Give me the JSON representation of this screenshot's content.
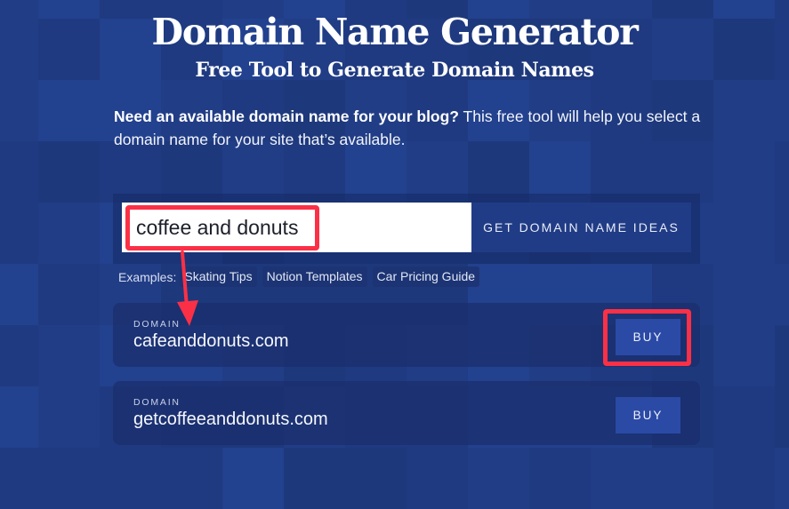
{
  "header": {
    "title": "Domain Name Generator",
    "subtitle": "Free Tool to Generate Domain Names"
  },
  "intro": {
    "bold": "Need an available domain name for your blog?",
    "text": " This free tool will help you select a domain name for your site that’s available."
  },
  "search": {
    "value": "coffee and donuts",
    "placeholder": "",
    "button_label": "GET DOMAIN NAME IDEAS"
  },
  "examples": {
    "label": "Examples:",
    "items": [
      "Skating Tips",
      "Notion Templates",
      "Car Pricing Guide"
    ]
  },
  "results": [
    {
      "label": "DOMAIN",
      "domain": "cafeanddonuts.com",
      "button_label": "BUY"
    },
    {
      "label": "DOMAIN",
      "domain": "getcoffeeanddonuts.com",
      "button_label": "BUY"
    }
  ],
  "annotations": {
    "highlight_color": "#fb3046",
    "items": [
      "search-input-highlight",
      "buy-button-highlight",
      "arrow-input-to-result"
    ]
  },
  "colors": {
    "background": "#213c85",
    "tile_shades": [
      "#1f3a80",
      "#213d86",
      "#22418e",
      "#1e387c"
    ],
    "buy_button": "#2a4aa6",
    "input_bg": "#ffffff"
  }
}
